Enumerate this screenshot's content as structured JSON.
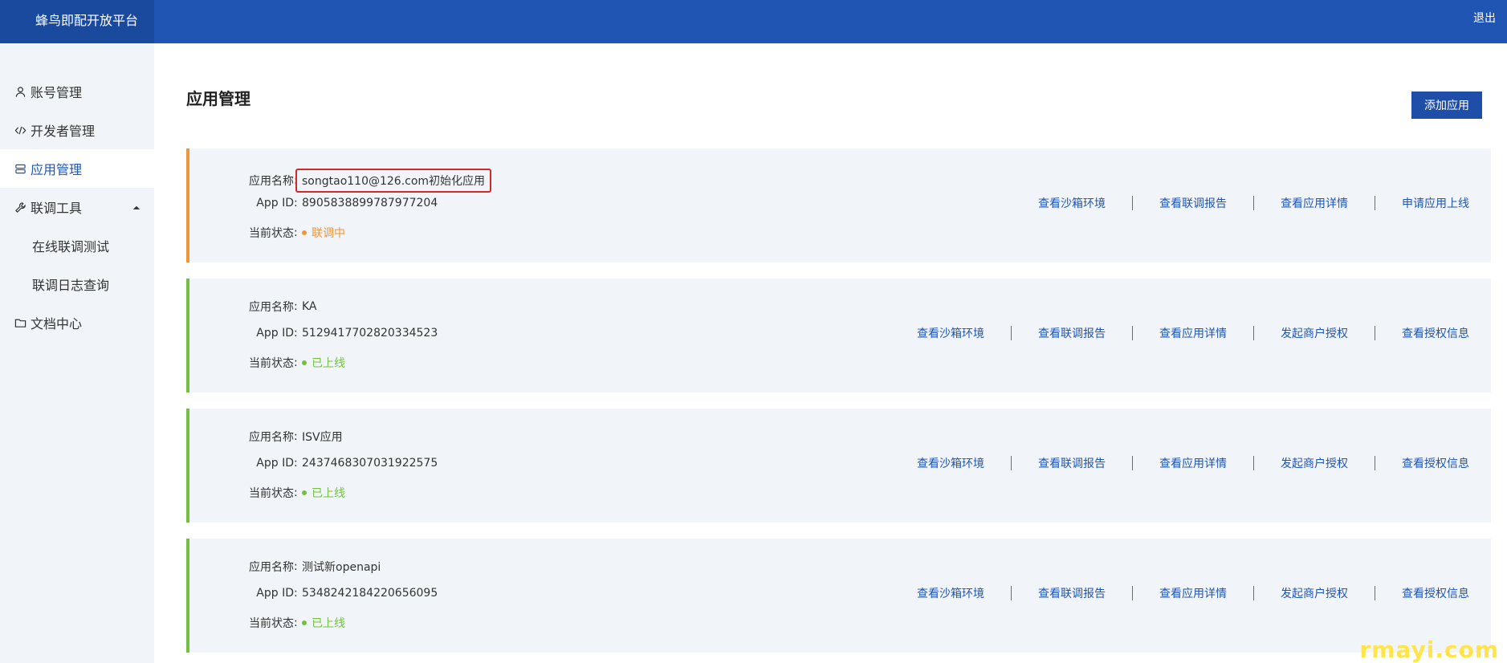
{
  "header": {
    "brand": "蜂鸟即配开放平台",
    "logout": "退出"
  },
  "sidebar": {
    "items": [
      {
        "label": "账号管理"
      },
      {
        "label": "开发者管理"
      },
      {
        "label": "应用管理"
      },
      {
        "label": "联调工具"
      },
      {
        "label": "在线联调测试"
      },
      {
        "label": "联调日志查询"
      },
      {
        "label": "文档中心"
      }
    ]
  },
  "main": {
    "title": "应用管理",
    "add_button": "添加应用",
    "field_labels": {
      "name": "应用名称",
      "app_id": "App ID",
      "status": "当前状态",
      "colon": ":"
    },
    "apps": [
      {
        "name": "songtao110@126.com初始化应用",
        "app_id": "8905838899787977204",
        "status": "联调中",
        "actions": [
          "查看沙箱环境",
          "查看联调报告",
          "查看应用详情",
          "申请应用上线"
        ]
      },
      {
        "name": "KA",
        "app_id": "5129417702820334523",
        "status": "已上线",
        "actions": [
          "查看沙箱环境",
          "查看联调报告",
          "查看应用详情",
          "发起商户授权",
          "查看授权信息"
        ]
      },
      {
        "name": "ISV应用",
        "app_id": "2437468307031922575",
        "status": "已上线",
        "actions": [
          "查看沙箱环境",
          "查看联调报告",
          "查看应用详情",
          "发起商户授权",
          "查看授权信息"
        ]
      },
      {
        "name": "测试新openapi",
        "app_id": "5348242184220656095",
        "status": "已上线",
        "actions": [
          "查看沙箱环境",
          "查看联调报告",
          "查看应用详情",
          "发起商户授权",
          "查看授权信息"
        ]
      }
    ]
  },
  "watermark": "rmayi.com",
  "colors": {
    "header": "#2055b3",
    "accent": "#1f55b3",
    "testing": "#f0963a",
    "online": "#73c040",
    "highlight": "#d42929"
  }
}
